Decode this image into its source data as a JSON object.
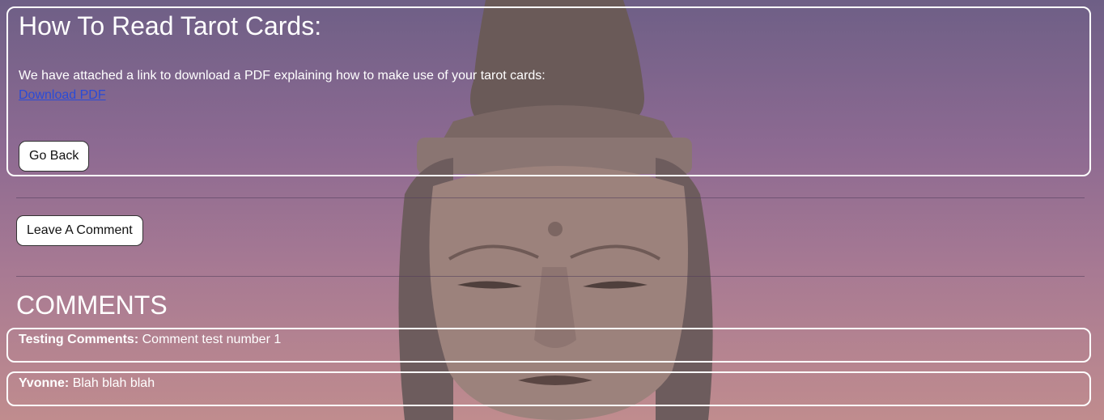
{
  "article": {
    "title": "How To Read Tarot Cards:",
    "intro": "We have attached a link to download a PDF explaining how to make use of your tarot cards:",
    "download_link": "Download PDF",
    "back_button": "Go Back"
  },
  "actions": {
    "leave_comment_button": "Leave A Comment"
  },
  "comments": {
    "heading": "COMMENTS",
    "items": [
      {
        "author": "Testing Comments:",
        "text": "Comment test number 1"
      },
      {
        "author": "Yvonne:",
        "text": "Blah blah blah"
      }
    ]
  },
  "colors": {
    "link": "#2a4bd7",
    "panel_border": "#ffffff",
    "text": "#ffffff"
  }
}
